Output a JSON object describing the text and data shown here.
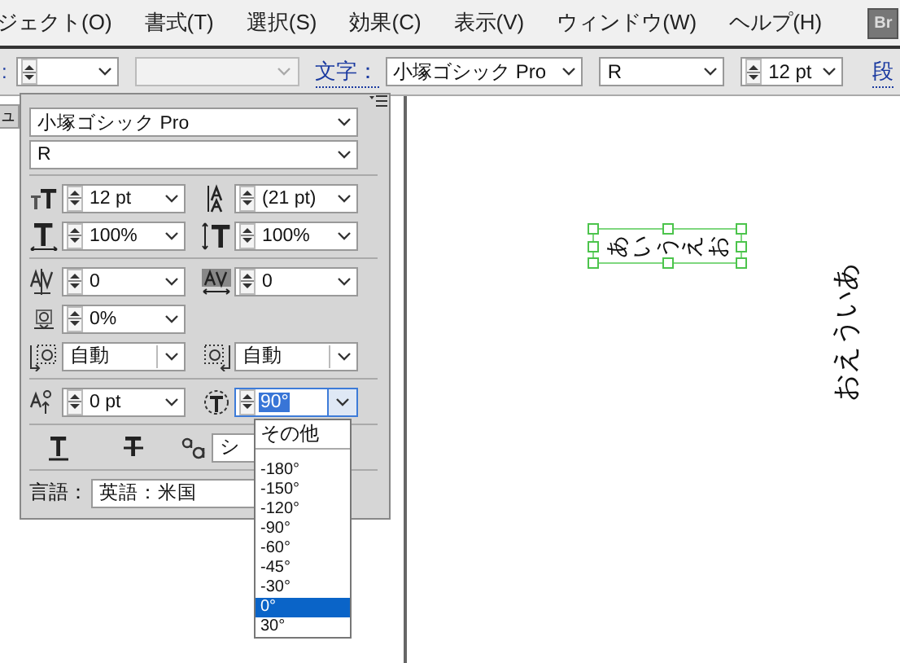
{
  "menu_bar": {
    "items": [
      "ジェクト(O)",
      "書式(T)",
      "選択(S)",
      "効果(C)",
      "表示(V)",
      "ウィンドウ(W)",
      "ヘルプ(H)"
    ],
    "app_badge": "Br"
  },
  "control_bar": {
    "lead_label": ":",
    "fields": [
      {
        "kind": "spin",
        "disabled": false
      },
      {
        "kind": "plain",
        "disabled": true
      }
    ],
    "label": "文字：",
    "selects": [
      {
        "kind": "plain",
        "value": "小塚ゴシック Pro"
      },
      {
        "kind": "plain",
        "value": "R"
      },
      {
        "kind": "spin",
        "value": "12 pt"
      }
    ],
    "trail_label": "段"
  },
  "panel": {
    "tab_label": "ュ",
    "font_family": "小塚ゴシック Pro",
    "font_style": "R",
    "sections": [
      [
        [
          {
            "kind": "spin",
            "value": "12 pt"
          },
          {
            "kind": "spin",
            "value": "(21 pt)"
          }
        ],
        [
          {
            "kind": "spin",
            "value": "100%"
          },
          {
            "kind": "spin",
            "value": "100%"
          }
        ]
      ],
      [
        [
          {
            "kind": "spin",
            "value": "0"
          },
          {
            "kind": "spin",
            "value": "0"
          }
        ],
        [
          {
            "kind": "spin",
            "value": "0%"
          }
        ],
        [
          {
            "kind": "combo",
            "value": "自動"
          },
          {
            "kind": "combo",
            "value": "自動"
          }
        ]
      ],
      [
        [
          {
            "kind": "spin",
            "value": "0 pt"
          },
          {
            "kind": "spin",
            "value": "90°",
            "selected": true,
            "open": true
          }
        ]
      ],
      [
        [
          {
            "kind": "toggle"
          },
          {
            "kind": "toggle"
          },
          {
            "kind": "combo",
            "value": "シ"
          }
        ]
      ]
    ],
    "language": {
      "label": "言語：",
      "value": "英語：米国"
    }
  },
  "dropdown": {
    "items": [
      {
        "kind": "option",
        "label": "その他",
        "selected": false
      },
      {
        "kind": "separator"
      },
      {
        "kind": "option",
        "label": "-180°",
        "selected": false
      },
      {
        "kind": "option",
        "label": "-150°",
        "selected": false
      },
      {
        "kind": "option",
        "label": "-120°",
        "selected": false
      },
      {
        "kind": "option",
        "label": "-90°",
        "selected": false
      },
      {
        "kind": "option",
        "label": "-60°",
        "selected": false
      },
      {
        "kind": "option",
        "label": "-45°",
        "selected": false
      },
      {
        "kind": "option",
        "label": "-30°",
        "selected": false
      },
      {
        "kind": "option",
        "label": "0°",
        "selected": true
      },
      {
        "kind": "option",
        "label": "30°",
        "selected": false
      }
    ]
  },
  "canvas": {
    "objects": [
      {
        "kind": "rotated_chars",
        "text": "あいうえお",
        "selected": true
      },
      {
        "kind": "vertical",
        "text": "おえういあ"
      }
    ]
  }
}
